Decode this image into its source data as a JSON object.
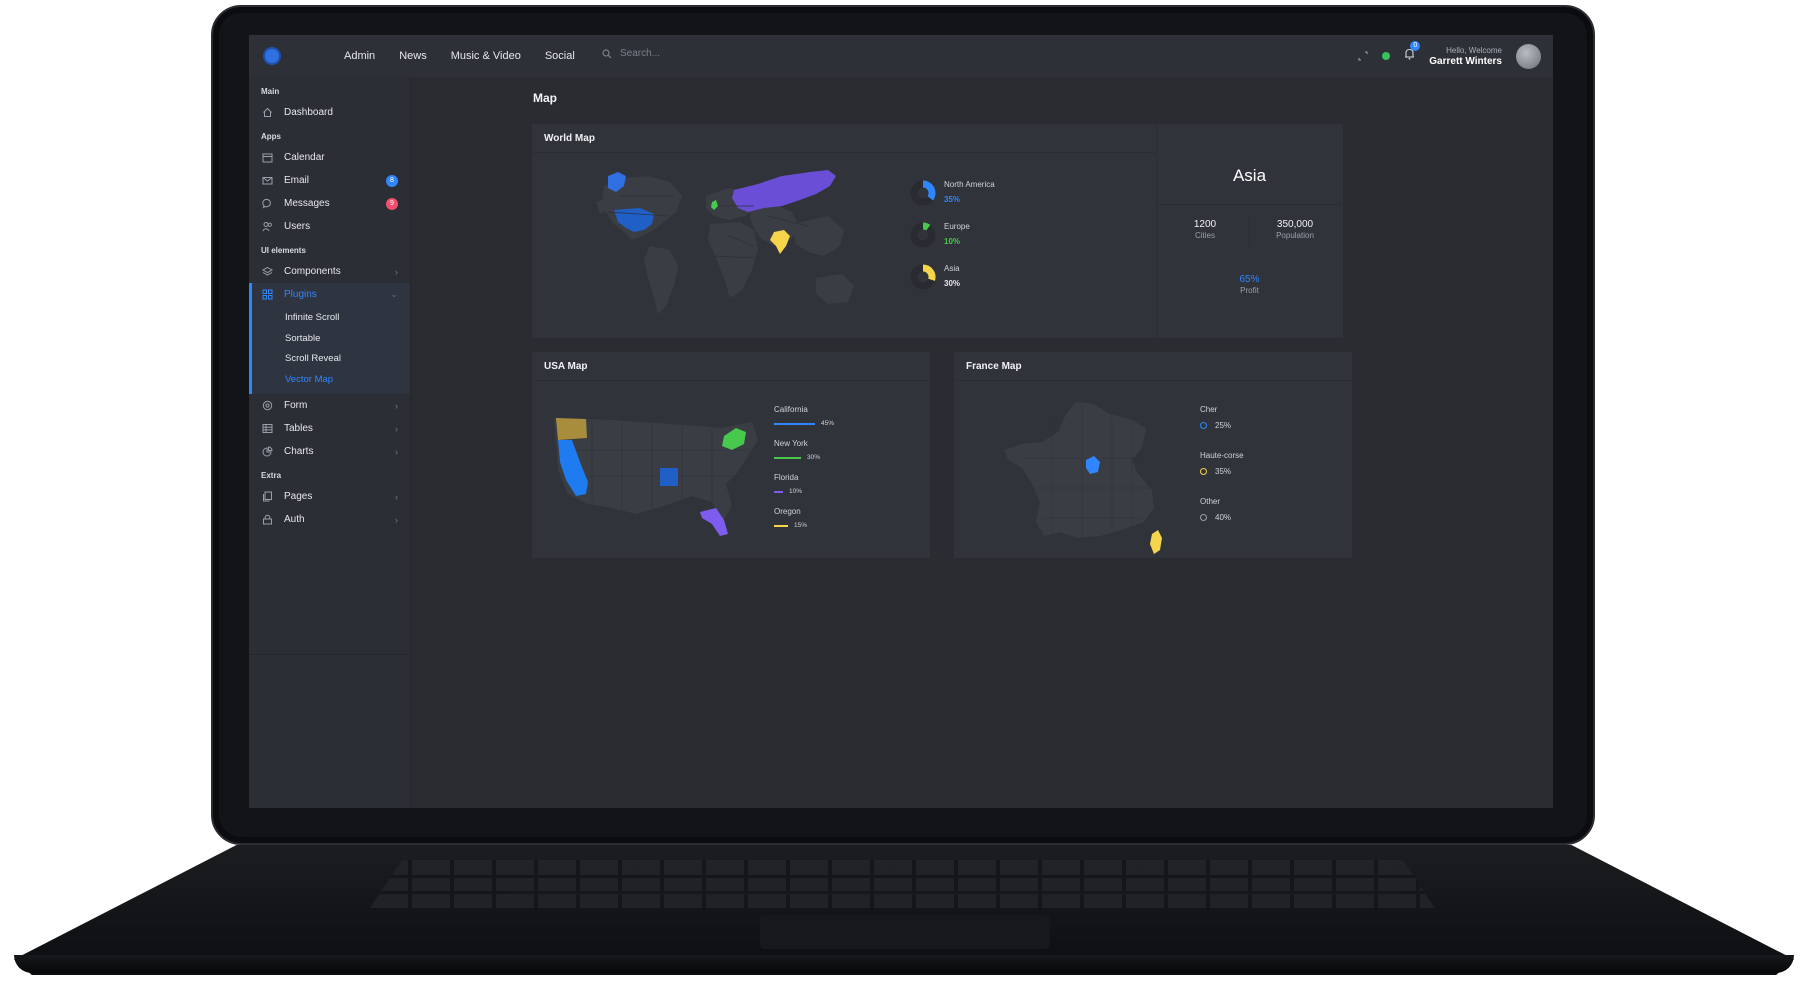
{
  "topbar": {
    "nav": [
      "Admin",
      "News",
      "Music & Video",
      "Social"
    ],
    "search_placeholder": "Search...",
    "notification_count": "0",
    "welcome": "Hello, Welcome",
    "user_name": "Garrett Winters"
  },
  "sidebar": {
    "sections": {
      "main": "Main",
      "apps": "Apps",
      "ui": "UI elements",
      "extra": "Extra"
    },
    "dashboard": "Dashboard",
    "calendar": "Calendar",
    "email": "Email",
    "email_count": "8",
    "messages": "Messages",
    "messages_count": "9",
    "users": "Users",
    "components": "Components",
    "plugins": "Plugins",
    "plugins_sub": [
      "Infinite Scroll",
      "Sortable",
      "Scroll Reveal",
      "Vector Map"
    ],
    "form": "Form",
    "tables": "Tables",
    "charts": "Charts",
    "pages": "Pages",
    "auth": "Auth"
  },
  "page": {
    "title": "Map"
  },
  "world_map": {
    "title": "World Map",
    "legend": [
      {
        "name": "North America",
        "percent": "35%",
        "value": 35,
        "color": "#2f86ff"
      },
      {
        "name": "Europe",
        "percent": "10%",
        "value": 10,
        "color": "#46c94d"
      },
      {
        "name": "Asia",
        "percent": "30%",
        "value": 30,
        "color": "#f6d54a"
      }
    ],
    "region": {
      "name": "Asia",
      "cities": "1200",
      "cities_label": "Cities",
      "population": "350,000",
      "population_label": "Population",
      "profit": "65%",
      "profit_label": "Profit"
    }
  },
  "usa_map": {
    "title": "USA Map",
    "legend": [
      {
        "name": "California",
        "percent": "45%",
        "value": 45,
        "color": "#2f86ff"
      },
      {
        "name": "New York",
        "percent": "30%",
        "value": 30,
        "color": "#46c94d"
      },
      {
        "name": "Florida",
        "percent": "10%",
        "value": 10,
        "color": "#7f5cf0"
      },
      {
        "name": "Oregon",
        "percent": "15%",
        "value": 15,
        "color": "#f6d54a"
      }
    ]
  },
  "france_map": {
    "title": "France Map",
    "legend": [
      {
        "name": "Cher",
        "percent": "25%",
        "color": "#2f86ff"
      },
      {
        "name": "Haute-corse",
        "percent": "35%",
        "color": "#f6d54a"
      },
      {
        "name": "Other",
        "percent": "40%",
        "color": "#9aa0aa"
      }
    ]
  },
  "colors": {
    "accent": "#2f86ff",
    "green": "#46c94d",
    "purple": "#7f5cf0",
    "yellow": "#f6d54a",
    "olive": "#a88e3c",
    "email_badge": "#2f86ff",
    "messages_badge": "#f0506e"
  }
}
